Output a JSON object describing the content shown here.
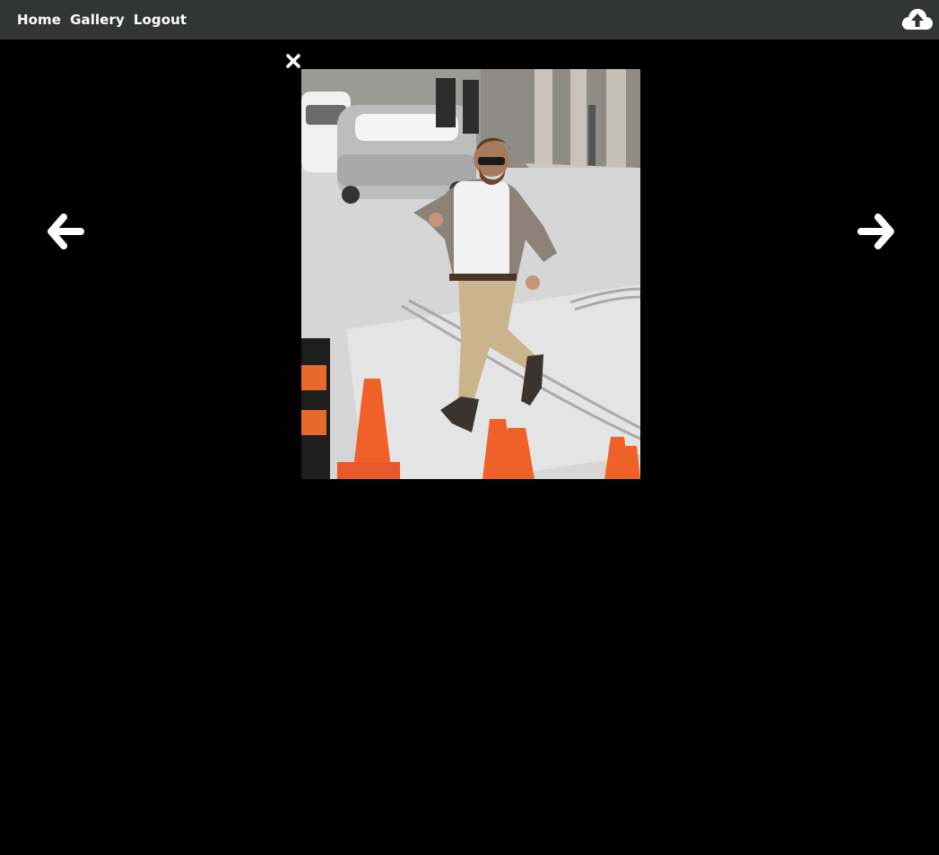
{
  "nav": {
    "links": [
      "Home",
      "Gallery",
      "Logout"
    ]
  },
  "icons": {
    "upload": "cloud-upload-icon",
    "close": "close-icon",
    "prev": "arrow-left-icon",
    "next": "arrow-right-icon"
  },
  "colors": {
    "navbar_bg": "#333434",
    "page_bg": "#000000",
    "icon": "#ffffff"
  },
  "lightbox": {
    "image_alt": "photo"
  }
}
